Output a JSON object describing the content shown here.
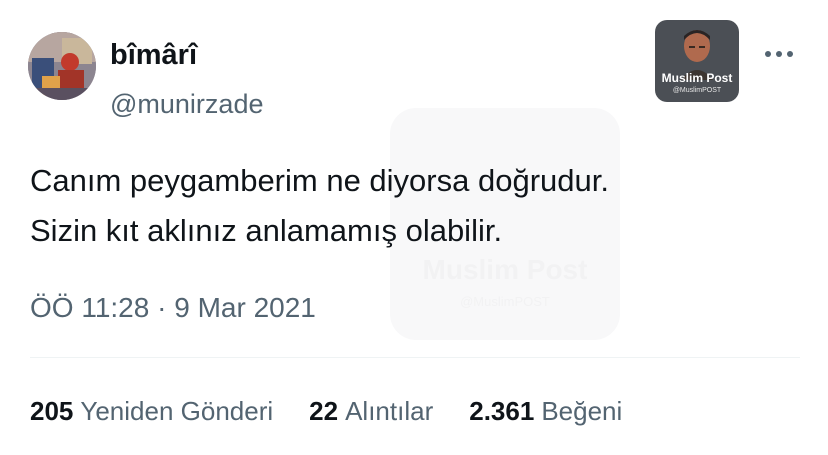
{
  "author": {
    "display_name": "bîmârî",
    "handle": "@munirzade"
  },
  "tweet": {
    "lines": [
      "Canım peygamberim ne diyorsa doğrudur.",
      "Sizin kıt aklınız anlamamış olabilir."
    ],
    "timestamp": "ÖÖ 11:28 · 9 Mar 2021"
  },
  "watermark": {
    "title": "Muslim Post",
    "subtitle": "@MuslimPOST"
  },
  "stats": {
    "retweets": {
      "count": "205",
      "label": "Yeniden Gönderi"
    },
    "quotes": {
      "count": "22",
      "label": "Alıntılar"
    },
    "likes": {
      "count": "2.361",
      "label": "Beğeni"
    }
  },
  "icons": {
    "more": "more-horizontal-icon"
  },
  "colors": {
    "primary_text": "#0f1419",
    "secondary_text": "#536471",
    "divider": "#eff3f4",
    "watermark_bg": "#4b4f55"
  }
}
